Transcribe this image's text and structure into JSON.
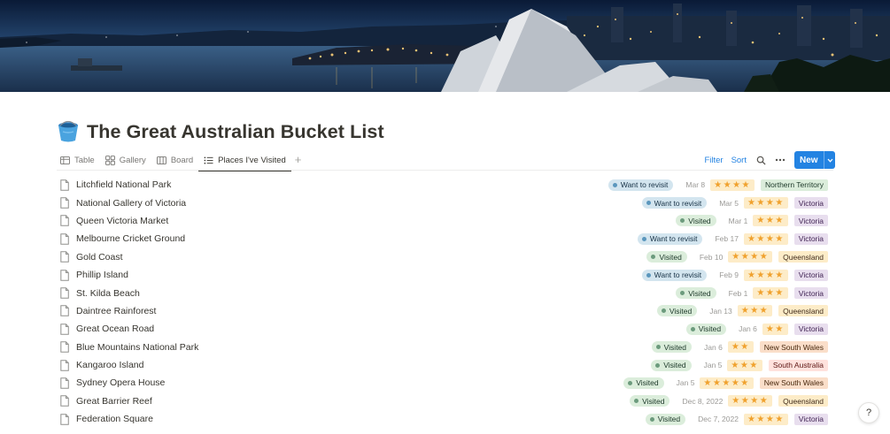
{
  "cover": {
    "image": "sydney-harbour-night"
  },
  "page": {
    "icon": "bucket-icon",
    "title": "The Great Australian Bucket List"
  },
  "tabs": [
    {
      "label": "Table",
      "icon": "table-icon"
    },
    {
      "label": "Gallery",
      "icon": "gallery-icon"
    },
    {
      "label": "Board",
      "icon": "board-icon"
    },
    {
      "label": "Places I've Visited",
      "icon": "list-icon",
      "active": true
    }
  ],
  "toolbar": {
    "filter": "Filter",
    "sort": "Sort",
    "new": "New"
  },
  "status_styles": {
    "Want to revisit": {
      "bg": "#d3e5ef",
      "dot": "#5b97bd",
      "text": "#183347"
    },
    "Visited": {
      "bg": "#dbeddb",
      "dot": "#6c9b7d",
      "text": "#1c3829"
    }
  },
  "region_styles": {
    "Northern Territory": {
      "bg": "#dbeddb",
      "text": "#1c3829"
    },
    "Victoria": {
      "bg": "#e8deee",
      "text": "#412454"
    },
    "Queensland": {
      "bg": "#fdecc8",
      "text": "#402c1b"
    },
    "New South Wales": {
      "bg": "#fadec9",
      "text": "#49290e"
    },
    "South Australia": {
      "bg": "#ffe2dd",
      "text": "#5d1715"
    }
  },
  "items": [
    {
      "name": "Litchfield National Park",
      "status": "Want to revisit",
      "date": "Mar 8",
      "rating": 4,
      "region": "Northern Territory"
    },
    {
      "name": "National Gallery of Victoria",
      "status": "Want to revisit",
      "date": "Mar 5",
      "rating": 4,
      "region": "Victoria"
    },
    {
      "name": "Queen Victoria Market",
      "status": "Visited",
      "date": "Mar 1",
      "rating": 3,
      "region": "Victoria"
    },
    {
      "name": "Melbourne Cricket Ground",
      "status": "Want to revisit",
      "date": "Feb 17",
      "rating": 4,
      "region": "Victoria"
    },
    {
      "name": "Gold Coast",
      "status": "Visited",
      "date": "Feb 10",
      "rating": 4,
      "region": "Queensland"
    },
    {
      "name": "Phillip Island",
      "status": "Want to revisit",
      "date": "Feb 9",
      "rating": 4,
      "region": "Victoria"
    },
    {
      "name": "St. Kilda Beach",
      "status": "Visited",
      "date": "Feb 1",
      "rating": 3,
      "region": "Victoria"
    },
    {
      "name": "Daintree Rainforest",
      "status": "Visited",
      "date": "Jan 13",
      "rating": 3,
      "region": "Queensland"
    },
    {
      "name": "Great Ocean Road",
      "status": "Visited",
      "date": "Jan 6",
      "rating": 2,
      "region": "Victoria"
    },
    {
      "name": "Blue Mountains National Park",
      "status": "Visited",
      "date": "Jan 6",
      "rating": 2,
      "region": "New South Wales"
    },
    {
      "name": "Kangaroo Island",
      "status": "Visited",
      "date": "Jan 5",
      "rating": 3,
      "region": "South Australia"
    },
    {
      "name": "Sydney Opera House",
      "status": "Visited",
      "date": "Jan 5",
      "rating": 5,
      "region": "New South Wales"
    },
    {
      "name": "Great Barrier Reef",
      "status": "Visited",
      "date": "Dec 8, 2022",
      "rating": 4,
      "region": "Queensland"
    },
    {
      "name": "Federation Square",
      "status": "Visited",
      "date": "Dec 7, 2022",
      "rating": 4,
      "region": "Victoria"
    }
  ],
  "help": {
    "label": "?"
  }
}
